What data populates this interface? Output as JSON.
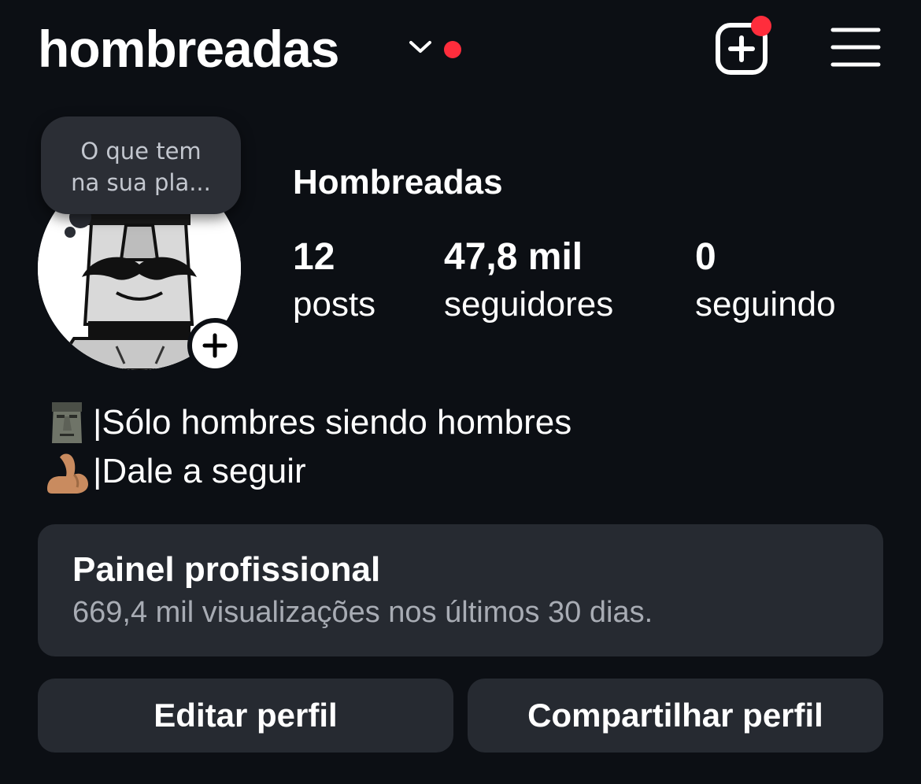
{
  "header": {
    "username": "hombreadas",
    "dropdown_icon": "chevron-down-icon",
    "has_notification": true,
    "create_icon": "plus-square-icon",
    "menu_icon": "hamburger-menu-icon",
    "notification_color": "#ff2d3c"
  },
  "profile": {
    "display_name": "Hombreadas",
    "note": {
      "line1": "O que tem",
      "line2": "na sua pla..."
    },
    "avatar_icon": "moustache-face-illustration",
    "story_add_icon": "plus-icon"
  },
  "stats": {
    "posts": {
      "value": "12",
      "label": "posts"
    },
    "followers": {
      "value": "47,8 mil",
      "label": "seguidores"
    },
    "following": {
      "value": "0",
      "label": "seguindo"
    }
  },
  "bio": {
    "line1": "|Sólo hombres siendo hombres",
    "line1_emoji": "moai-icon",
    "line2": "|Dale a seguir",
    "line2_emoji": "flexed-biceps-icon"
  },
  "dashboard": {
    "title": "Painel profissional",
    "subtitle": "669,4 mil visualizações nos últimos 30 dias."
  },
  "actions": {
    "edit_label": "Editar perfil",
    "share_label": "Compartilhar perfil"
  },
  "colors": {
    "background": "#0c0f14",
    "surface": "#262a31",
    "muted_text": "#a8acb4"
  }
}
